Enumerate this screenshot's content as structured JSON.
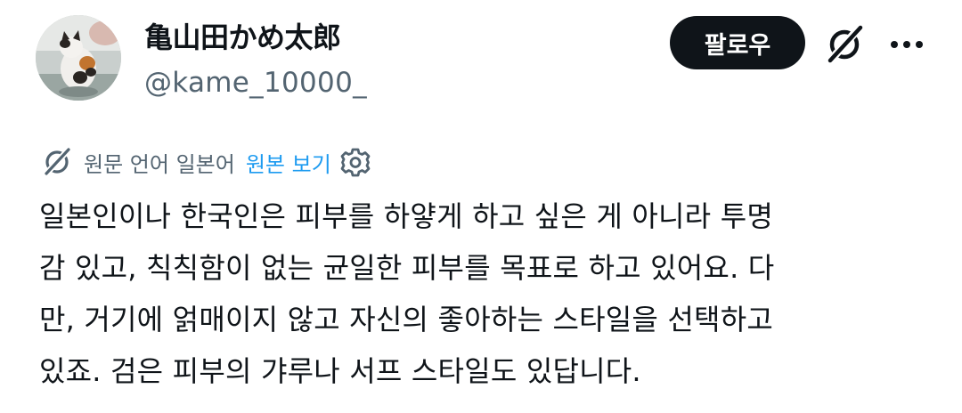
{
  "author": {
    "display_name": "亀山田かめ太郎",
    "handle": "@kame_10000_"
  },
  "actions": {
    "follow_label": "팔로우",
    "grok_icon": "grok-slash-icon",
    "more_icon": "more-horizontal-icon"
  },
  "translation": {
    "language_label": "원문 언어 일본어",
    "view_original_label": "원본 보기",
    "settings_icon": "gear-icon"
  },
  "tweet": {
    "lines": [
      "일본인이나 한국인은 피부를 하얗게 하고 싶은 게 아니라 투명",
      "감 있고, 칙칙함이 없는 균일한 피부를 목표로 하고 있어요. 다",
      "만, 거기에 얽매이지 않고 자신의 좋아하는 스타일을 선택하고",
      "있죠. 검은 피부의 갸루나 서프 스타일도 있답니다."
    ]
  },
  "colors": {
    "text_primary": "#0f1419",
    "text_secondary": "#536471",
    "link": "#1d9bf0",
    "button_bg": "#0f1419"
  }
}
